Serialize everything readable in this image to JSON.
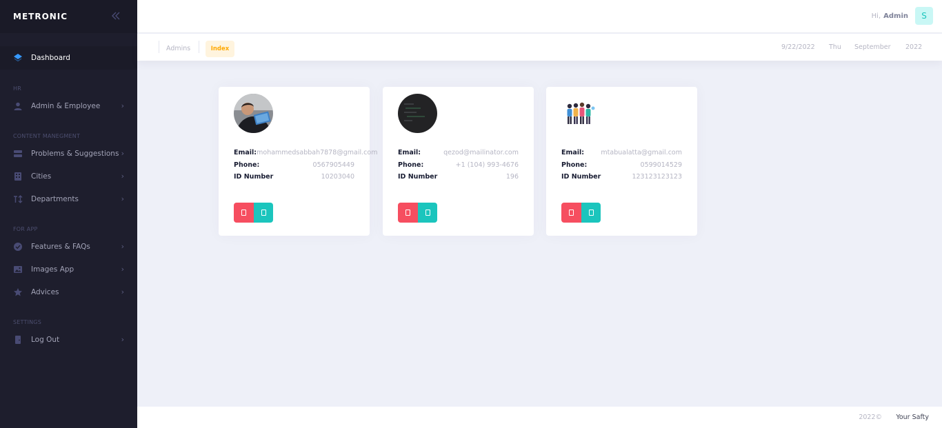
{
  "sidebar": {
    "brand": "METRONIC",
    "toggle_icon": "double-chevron-left-icon",
    "dashboard": "Dashboard",
    "sections": {
      "hr": "HR",
      "content": "CONTENT MANEGMENT",
      "app": "FOR APP",
      "settings": "SETTINGS"
    },
    "items": {
      "admin_employee": "Admin & Employee",
      "problems": "Problems & Suggestions",
      "cities": "Cities",
      "departments": "Departments",
      "features": "Features & FAQs",
      "images": "Images App",
      "advices": "Advices",
      "logout": "Log Out"
    }
  },
  "header": {
    "greeting": "Hi,",
    "user_name": "Admin",
    "avatar_letter": "S"
  },
  "subheader": {
    "crumb_admins": "Admins",
    "crumb_index": "Index",
    "date": "9/22/2022",
    "day": "Thu",
    "month": "September",
    "year": "2022"
  },
  "labels": {
    "email": "Email:",
    "phone": "Phone:",
    "id_number": "ID Number"
  },
  "cards": [
    {
      "email": "mohammedsabbah7878@gmail.com",
      "phone": "0567905449",
      "id_number": "10203040"
    },
    {
      "email": "qezod@mailinator.com",
      "phone": "+1 (104) 993-4676",
      "id_number": "196"
    },
    {
      "email": "mtabualatta@gmail.com",
      "phone": "0599014529",
      "id_number": "123123123123"
    }
  ],
  "footer": {
    "year": "2022©",
    "brand": "Your Safty"
  },
  "colors": {
    "sidebar_bg": "#1E1E2D",
    "primary": "#3699FF",
    "danger": "#F64E60",
    "info": "#1BC5BD",
    "warning": "#FFA800"
  }
}
